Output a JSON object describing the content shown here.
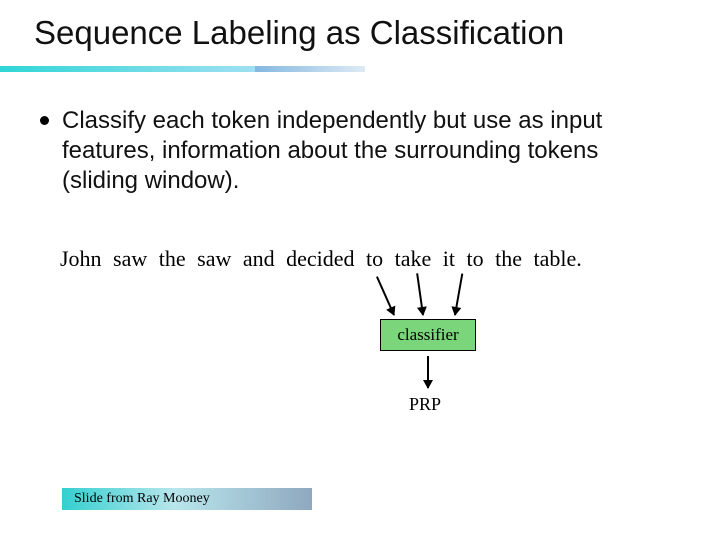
{
  "title": "Sequence Labeling as Classification",
  "bullet": "Classify each token independently but use as input features, information about the surrounding tokens (sliding window).",
  "sentence": "John  saw  the  saw  and  decided  to  take  it    to  the   table.",
  "classifier_label": "classifier",
  "output_tag": "PRP",
  "footer": "Slide from Ray Mooney"
}
